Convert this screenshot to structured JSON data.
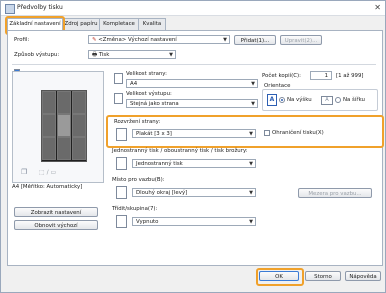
{
  "window": {
    "title": "Předvolby tisku",
    "close_glyph": "✕"
  },
  "tabs": [
    {
      "label": "Základní nastavení"
    },
    {
      "label": "Zdroj papíru"
    },
    {
      "label": "Kompletace"
    },
    {
      "label": "Kvalita"
    }
  ],
  "profile": {
    "label": "Profil:",
    "value": "<Změna> Výchozí nastavení",
    "add_button": "Přidat(1)...",
    "edit_button": "Upravit(2)..."
  },
  "output": {
    "label": "Způsob výstupu:",
    "value": "Tisk"
  },
  "preview": {
    "caption": "A4 [Měřítko: Automaticky]",
    "show_settings_button": "Zobrazit nastavení",
    "restore_defaults_button": "Obnovit výchozí"
  },
  "page_size": {
    "label": "Velikost strany:",
    "value": "A4"
  },
  "output_size": {
    "label": "Velikost výstupu:",
    "value": "Stejná jako strana"
  },
  "copies": {
    "label": "Počet kopií(C):",
    "value": "1",
    "range": "[1 až 999]"
  },
  "orientation": {
    "label": "Orientace",
    "portrait": "Na výšku",
    "landscape": "Na šířku",
    "icon_letter": "A"
  },
  "layout": {
    "label": "Rozvržení strany:",
    "value": "Plakát [3 x 3]",
    "border_label": "Ohraničení tisku(X)"
  },
  "duplex": {
    "label": "Jednostranný tisk / oboustranný tisk / tisk brožury:",
    "value": "Jednostranný tisk"
  },
  "binding": {
    "label": "Místo pro vazbu(B):",
    "value": "Dlouhý okraj [levý]",
    "margin_button": "Mezera pro vazbu..."
  },
  "collate": {
    "label": "Třídit/skupina(7):",
    "value": "Vypnuto"
  },
  "footer": {
    "ok": "OK",
    "cancel": "Storno",
    "help": "Nápověda"
  }
}
